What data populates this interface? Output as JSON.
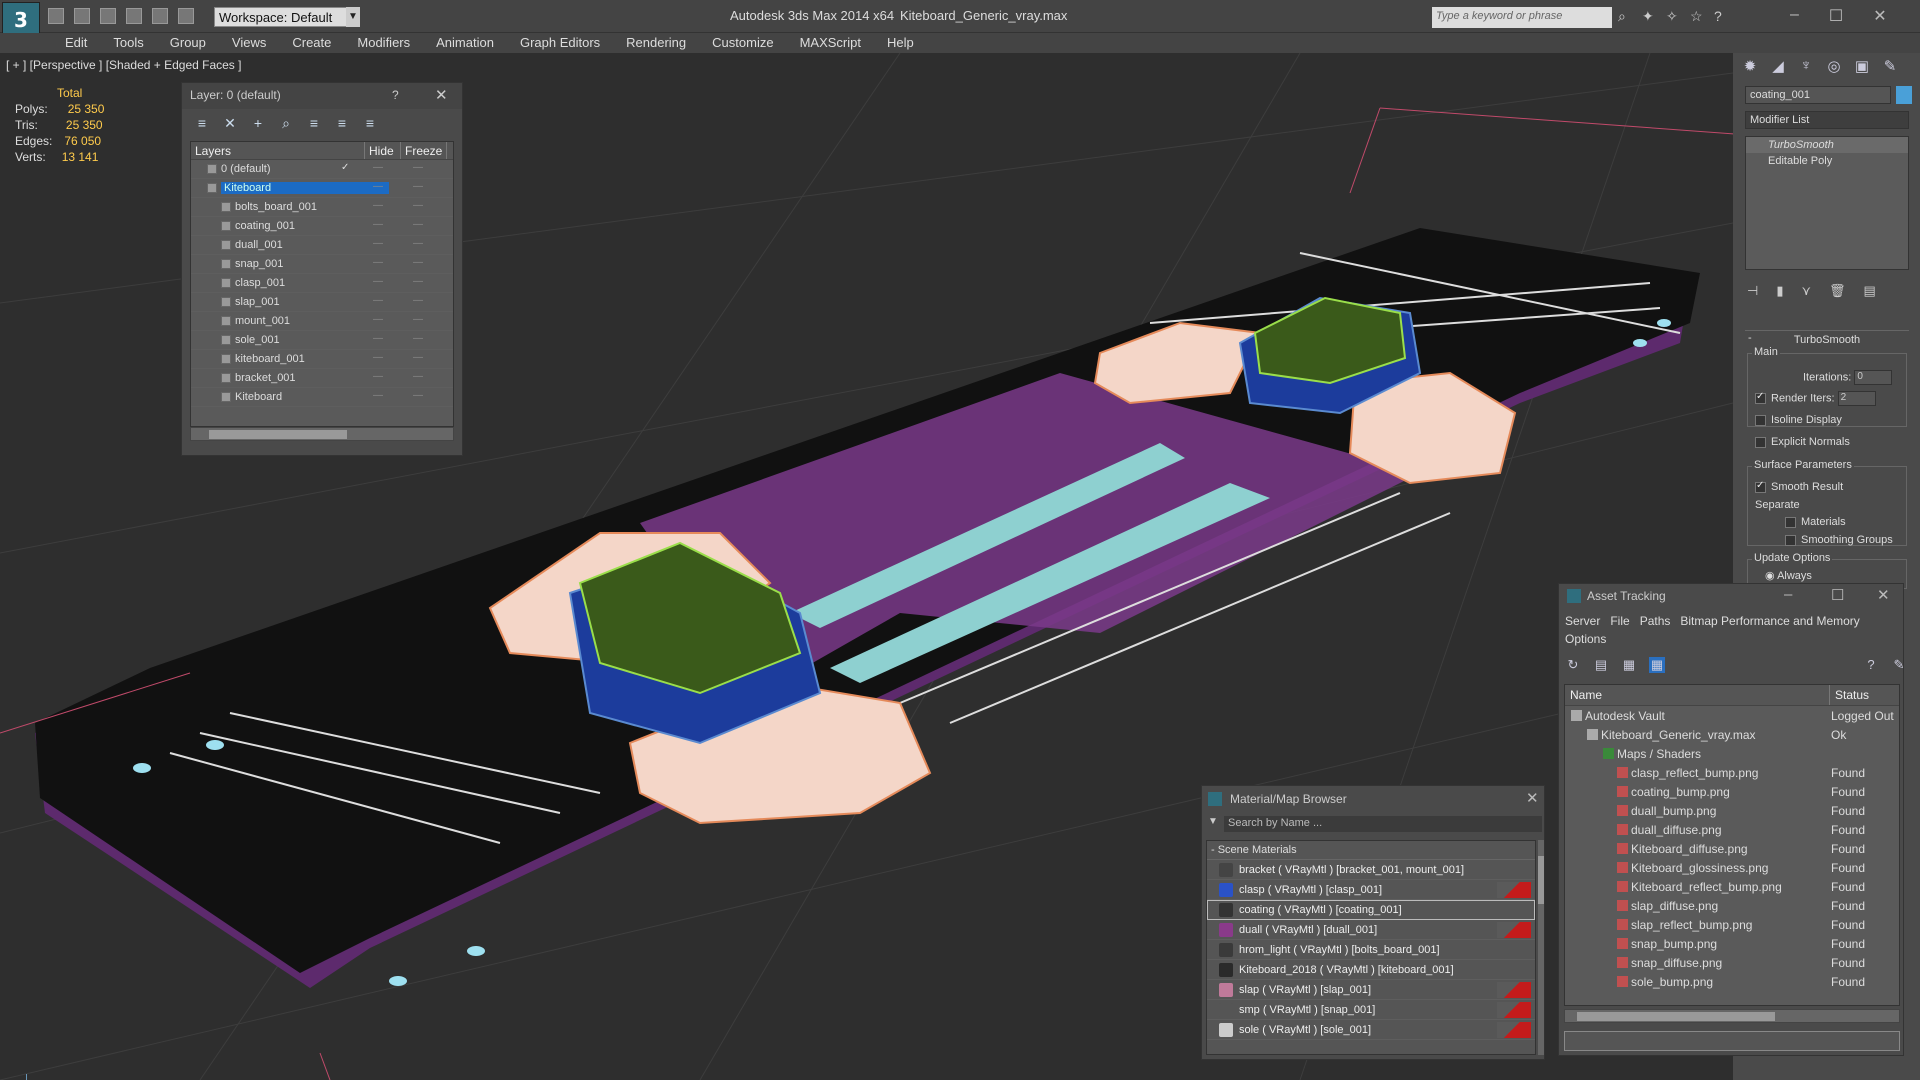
{
  "app": {
    "logo": "3",
    "title": "Autodesk 3ds Max  2014 x64",
    "file": "Kiteboard_Generic_vray.max",
    "workspace": "Workspace: Default",
    "search_placeholder": "Type a keyword or phrase"
  },
  "menu": [
    "Edit",
    "Tools",
    "Group",
    "Views",
    "Create",
    "Modifiers",
    "Animation",
    "Graph Editors",
    "Rendering",
    "Customize",
    "MAXScript",
    "Help"
  ],
  "viewport": {
    "label": "[ + ] [Perspective ] [Shaded + Edged Faces ]"
  },
  "stats": {
    "total_label": "Total",
    "polys_label": "Polys:",
    "polys": "25 350",
    "tris_label": "Tris:",
    "tris": "25 350",
    "edges_label": "Edges:",
    "edges": "76 050",
    "verts_label": "Verts:",
    "verts": "13 141"
  },
  "layers_window": {
    "title": "Layer: 0 (default)",
    "help": "?",
    "close": "✕",
    "col_layers": "Layers",
    "col_hide": "Hide",
    "col_freeze": "Freeze",
    "rows": [
      "0 (default)",
      "Kiteboard",
      "bolts_board_001",
      "coating_001",
      "duall_001",
      "snap_001",
      "clasp_001",
      "slap_001",
      "mount_001",
      "sole_001",
      "kiteboard_001",
      "bracket_001",
      "Kiteboard"
    ]
  },
  "command_panel": {
    "object_name": "coating_001",
    "modifier_list": "Modifier List",
    "stack": [
      "TurboSmooth",
      "Editable Poly"
    ],
    "rollout": "TurboSmooth",
    "main": "Main",
    "iterations_label": "Iterations:",
    "iterations": "0",
    "render_iters_label": "Render Iters:",
    "render_iters": "2",
    "isoline": "Isoline Display",
    "explicit": "Explicit Normals",
    "surface": "Surface Parameters",
    "smooth": "Smooth Result",
    "separate": "Separate",
    "materials": "Materials",
    "smoothing": "Smoothing Groups",
    "update": "Update Options",
    "always": "Always"
  },
  "asset_window": {
    "title": "Asset Tracking",
    "menu1": [
      "Server",
      "File",
      "Paths",
      "Bitmap Performance and Memory"
    ],
    "menu2": "Options",
    "col_name": "Name",
    "col_status": "Status",
    "rows": [
      {
        "name": "Autodesk Vault",
        "status": "Logged Out"
      },
      {
        "name": "Kiteboard_Generic_vray.max",
        "status": "Ok"
      },
      {
        "name": "Maps / Shaders",
        "status": ""
      },
      {
        "name": "clasp_reflect_bump.png",
        "status": "Found"
      },
      {
        "name": "coating_bump.png",
        "status": "Found"
      },
      {
        "name": "duall_bump.png",
        "status": "Found"
      },
      {
        "name": "duall_diffuse.png",
        "status": "Found"
      },
      {
        "name": "Kiteboard_diffuse.png",
        "status": "Found"
      },
      {
        "name": "Kiteboard_glossiness.png",
        "status": "Found"
      },
      {
        "name": "Kiteboard_reflect_bump.png",
        "status": "Found"
      },
      {
        "name": "slap_diffuse.png",
        "status": "Found"
      },
      {
        "name": "slap_reflect_bump.png",
        "status": "Found"
      },
      {
        "name": "snap_bump.png",
        "status": "Found"
      },
      {
        "name": "snap_diffuse.png",
        "status": "Found"
      },
      {
        "name": "sole_bump.png",
        "status": "Found"
      }
    ]
  },
  "material_window": {
    "title": "Material/Map Browser",
    "search": "Search by Name ...",
    "group": "- Scene Materials",
    "rows": [
      {
        "name": "bracket  ( VRayMtl ) [bracket_001, mount_001]",
        "color": "#444444",
        "red": false
      },
      {
        "name": "clasp  ( VRayMtl ) [clasp_001]",
        "color": "#2a52c8",
        "red": true
      },
      {
        "name": "coating  ( VRayMtl ) [coating_001]",
        "color": "#333333",
        "red": false
      },
      {
        "name": "duall  ( VRayMtl ) [duall_001]",
        "color": "#8a3a8a",
        "red": true
      },
      {
        "name": "hrom_light  ( VRayMtl ) [bolts_board_001]",
        "color": "#3a3a3a",
        "red": false
      },
      {
        "name": "Kiteboard_2018  ( VRayMtl ) [kiteboard_001]",
        "color": "#2a2a2a",
        "red": false
      },
      {
        "name": "slap  ( VRayMtl ) [slap_001]",
        "color": "#c07a9a",
        "red": true
      },
      {
        "name": "smp  ( VRayMtl ) [snap_001]",
        "color": "#555555",
        "red": true
      },
      {
        "name": "sole  ( VRayMtl ) [sole_001]",
        "color": "#cccccc",
        "red": true
      }
    ]
  }
}
